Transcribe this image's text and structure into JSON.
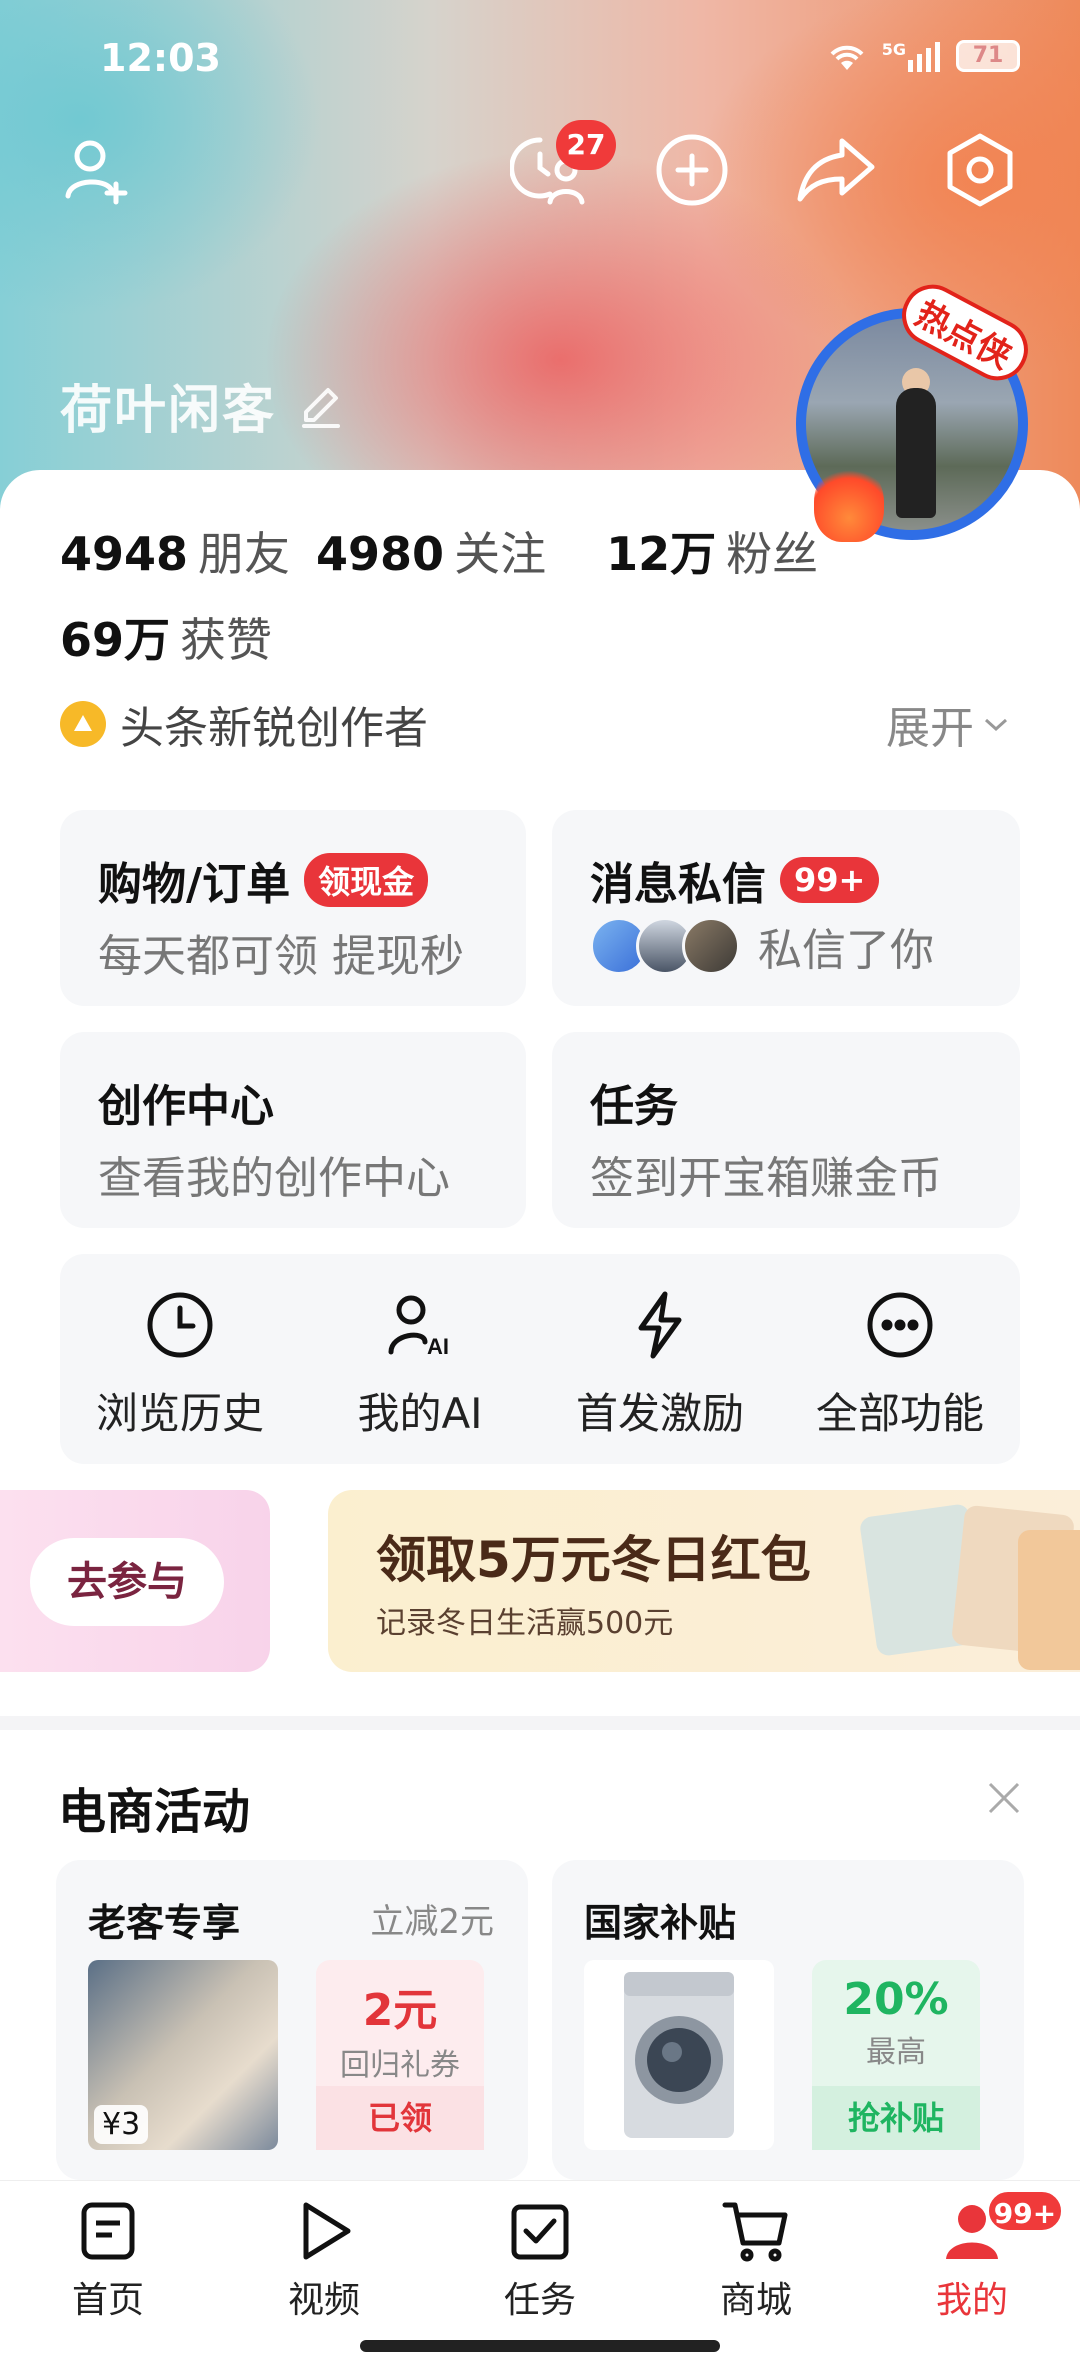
{
  "status_bar": {
    "time": "12:03",
    "battery": "71",
    "network": "5G"
  },
  "header": {
    "notification_count": "27",
    "username": "荷叶闲客"
  },
  "profile": {
    "hot_tag": "热点侠",
    "stats": [
      {
        "value": "4948",
        "label": "朋友"
      },
      {
        "value": "4980",
        "label": "关注"
      },
      {
        "value": "12万",
        "label": "粉丝"
      },
      {
        "value": "69万",
        "label": "获赞"
      }
    ],
    "creator_label": "头条新锐创作者",
    "expand_label": "展开"
  },
  "cards": {
    "shopping": {
      "title": "购物/订单",
      "badge": "领现金",
      "subtitle": "每天都可领 提现秒"
    },
    "messages": {
      "title": "消息私信",
      "badge": "99+",
      "subtitle": "私信了你"
    },
    "creation": {
      "title": "创作中心",
      "subtitle": "查看我的创作中心"
    },
    "tasks": {
      "title": "任务",
      "subtitle": "签到开宝箱赚金币"
    }
  },
  "tools": [
    {
      "label": "浏览历史",
      "icon": "clock-icon"
    },
    {
      "label": "我的AI",
      "icon": "ai-person-icon"
    },
    {
      "label": "首发激励",
      "icon": "lightning-icon"
    },
    {
      "label": "全部功能",
      "icon": "more-icon"
    }
  ],
  "banners": {
    "join_label": "去参与",
    "main_title": "领取5万元冬日红包",
    "main_subtitle": "记录冬日生活赢500元"
  },
  "ecommerce": {
    "title": "电商活动",
    "cards": [
      {
        "title": "老客专享",
        "aside": "立减2元",
        "price": "¥3",
        "coupon_big": "2元",
        "coupon_small": "回归礼券",
        "coupon_action": "已领"
      },
      {
        "title": "国家补贴",
        "aside": "",
        "coupon_big": "20%",
        "coupon_small": "最高",
        "coupon_action": "抢补贴"
      }
    ]
  },
  "tabbar": {
    "tabs": [
      {
        "label": "首页",
        "icon": "home-icon"
      },
      {
        "label": "视频",
        "icon": "play-icon"
      },
      {
        "label": "任务",
        "icon": "task-check-icon"
      },
      {
        "label": "商城",
        "icon": "cart-icon"
      },
      {
        "label": "我的",
        "icon": "person-icon"
      }
    ],
    "mine_badge": "99+"
  },
  "colors": {
    "accent_red": "#e9353a",
    "green": "#1fb561"
  }
}
